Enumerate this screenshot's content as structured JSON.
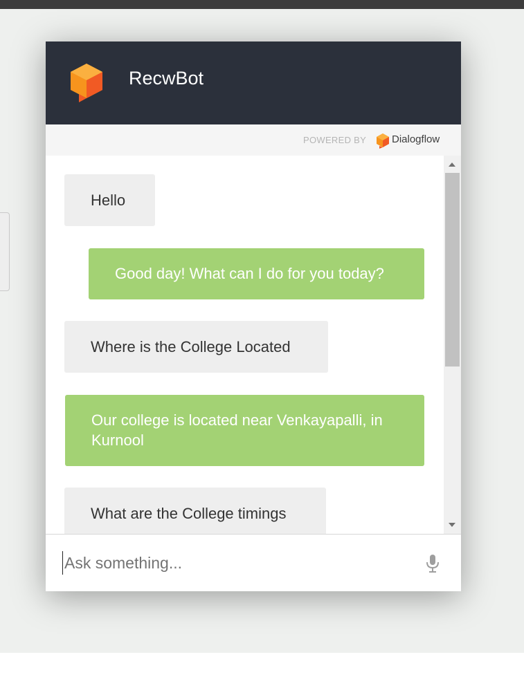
{
  "header": {
    "title": "RecwBot",
    "logo_icon": "dialogflow-speech-bubble-icon",
    "brand_color": "#f7941d",
    "background_color": "#2b303b"
  },
  "powered_by": {
    "label": "POWERED BY",
    "brand_name": "Dialogflow"
  },
  "messages": [
    {
      "sender": "user",
      "text": "Hello"
    },
    {
      "sender": "bot",
      "text": "Good day! What can I do for you today?"
    },
    {
      "sender": "user",
      "text": "Where is the College Located"
    },
    {
      "sender": "bot",
      "text": "Our college is located near Venkayapalli, in Kurnool"
    },
    {
      "sender": "user",
      "text": "What are the College timings"
    }
  ],
  "colors": {
    "user_bubble": "#eeeeee",
    "bot_bubble": "#a3d274"
  },
  "input": {
    "placeholder": "Ask something...",
    "value": "",
    "mic_icon": "microphone-icon"
  }
}
